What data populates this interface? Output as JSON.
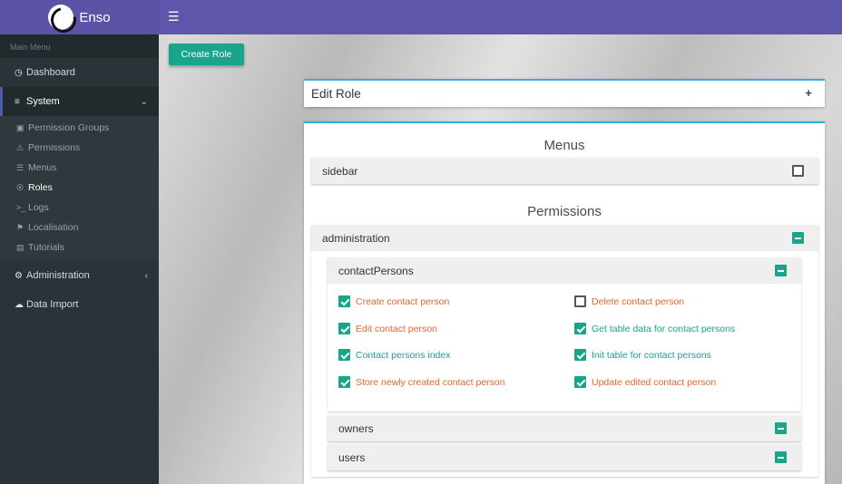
{
  "brand": {
    "name": "Enso"
  },
  "sidebar": {
    "header": "Main Menu",
    "items": [
      {
        "label": "Dashboard",
        "icon": "dashboard-icon"
      },
      {
        "label": "System",
        "icon": "sliders-icon"
      },
      {
        "label": "Administration",
        "icon": "gears-icon"
      },
      {
        "label": "Data Import",
        "icon": "cloud-upload-icon"
      }
    ],
    "system_sub": [
      {
        "label": "Permission Groups"
      },
      {
        "label": "Permissions"
      },
      {
        "label": "Menus"
      },
      {
        "label": "Roles"
      },
      {
        "label": "Logs"
      },
      {
        "label": "Localisation"
      },
      {
        "label": "Tutorials"
      }
    ]
  },
  "main": {
    "create_button": "Create Role",
    "edit_panel_title": "Edit Role",
    "menus_title": "Menus",
    "menus": [
      {
        "label": "sidebar",
        "state": "unchecked"
      }
    ],
    "permissions_title": "Permissions",
    "groups": [
      {
        "label": "administration",
        "state": "indeterminate",
        "children": [
          {
            "label": "contactPersons",
            "state": "indeterminate",
            "permissions": [
              {
                "label": "Create contact person",
                "checked": true,
                "color": "#e8642c"
              },
              {
                "label": "Delete contact person",
                "checked": false,
                "color": "#e8642c"
              },
              {
                "label": "Edit contact person",
                "checked": true,
                "color": "#e8642c"
              },
              {
                "label": "Get table data for contact persons",
                "checked": true,
                "color": "#18a58a"
              },
              {
                "label": "Contact persons index",
                "checked": true,
                "color": "#18a58a"
              },
              {
                "label": "Init table for contact persons",
                "checked": true,
                "color": "#18a58a"
              },
              {
                "label": "Store newly created contact person",
                "checked": true,
                "color": "#e8642c"
              },
              {
                "label": "Update edited contact person",
                "checked": true,
                "color": "#e8642c"
              }
            ]
          },
          {
            "label": "owners",
            "state": "indeterminate"
          },
          {
            "label": "users",
            "state": "indeterminate"
          }
        ]
      }
    ]
  },
  "colors": {
    "accent": "#18a58a",
    "header": "#5e56aa",
    "sidebar": "#2b3338",
    "warning_text": "#e8642c",
    "panel_border": "#2bb3e0"
  }
}
